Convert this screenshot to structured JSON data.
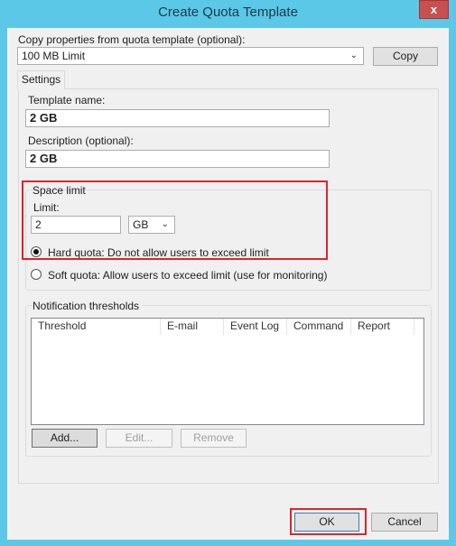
{
  "window": {
    "title": "Create Quota Template",
    "close_label": "x"
  },
  "copy": {
    "label": "Copy properties from quota template (optional):",
    "selected": "100 MB Limit",
    "button": "Copy"
  },
  "tabs": [
    {
      "label": "Settings"
    }
  ],
  "template_name": {
    "label": "Template name:",
    "value": "2 GB"
  },
  "description": {
    "label": "Description (optional):",
    "value": "2 GB"
  },
  "space_limit": {
    "title": "Space limit",
    "limit_label": "Limit:",
    "limit_value": "2",
    "unit": "GB",
    "hard_quota": "Hard quota: Do not allow users to exceed limit",
    "soft_quota": "Soft quota: Allow users to exceed limit (use for monitoring)",
    "selected": "hard"
  },
  "notifications": {
    "title": "Notification thresholds",
    "columns": [
      "Threshold",
      "E-mail",
      "Event Log",
      "Command",
      "Report"
    ],
    "rows": [],
    "add": "Add...",
    "edit": "Edit...",
    "remove": "Remove"
  },
  "footer": {
    "ok": "OK",
    "cancel": "Cancel"
  },
  "colors": {
    "frame": "#5bc8e8",
    "highlight": "#d9262e"
  }
}
